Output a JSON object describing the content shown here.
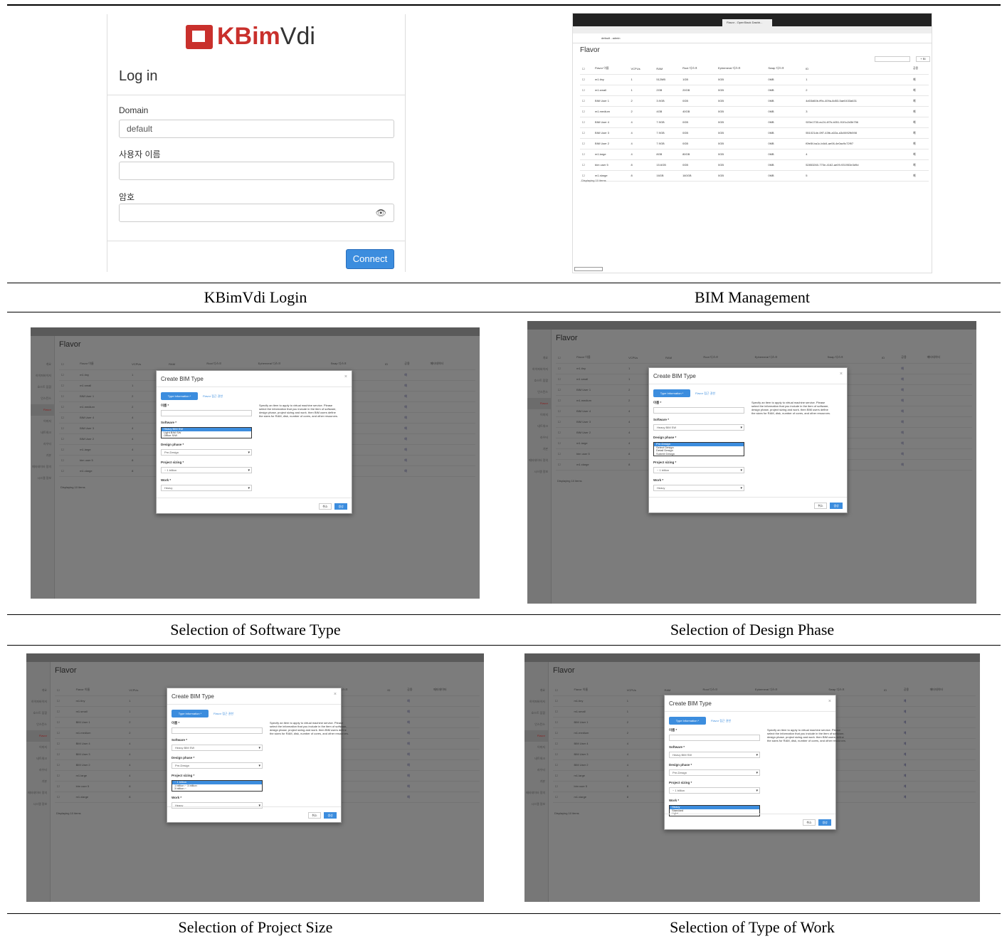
{
  "captions": {
    "login": "KBimVdi Login",
    "bim": "BIM Management",
    "software": "Selection of Software Type",
    "design": "Selection of Design Phase",
    "size": "Selection of Project Size",
    "work": "Selection of Type of Work"
  },
  "login": {
    "logo_kbim": "KBim",
    "logo_vdi": "Vdi",
    "title": "Log in",
    "domain_label": "Domain",
    "domain_value": "default",
    "user_label": "사용자 이름",
    "password_label": "암호",
    "connect": "Connect"
  },
  "bim": {
    "title": "Flavor",
    "admin": "default - admin",
    "tab": "Flavor - OpenStack Dashb...",
    "add_button": "+ BI",
    "columns": [
      "Flavor 이름",
      "VCPUs",
      "RAM",
      "Root 디스크",
      "Ephemeral 디스크",
      "Swap 디스크",
      "ID",
      "공용"
    ],
    "rows": [
      [
        "m1.tiny",
        "1",
        "512MB",
        "1GB",
        "0GB",
        "0MB",
        "1",
        "예"
      ],
      [
        "m1.small",
        "1",
        "2GB",
        "20GB",
        "0GB",
        "0MB",
        "2",
        "예"
      ],
      [
        "BIM User 1",
        "2",
        "3.9GB",
        "0GB",
        "0GB",
        "0MB",
        "4d03d60b-ff9c-409a-8d53-5ae0433a631",
        "예"
      ],
      [
        "m1.medium",
        "2",
        "4GB",
        "40GB",
        "0GB",
        "0MB",
        "3",
        "예"
      ],
      [
        "BIM User 4",
        "4",
        "7.9GB",
        "0GB",
        "0GB",
        "0MB",
        "920e1730-ec24-4f7b-b051-91f1c2d3b756",
        "예"
      ],
      [
        "BIM User 3",
        "4",
        "7.9GB",
        "0GB",
        "0GB",
        "0MB",
        "551021de-0ff7-43fb-a02a-a3c0692fb598",
        "예"
      ],
      [
        "BIM User 2",
        "4",
        "7.9GB",
        "0GB",
        "0GB",
        "0MB",
        "f0fe5f-ba1c-b4d4-ae06-4e0ac9c72f97",
        "예"
      ],
      [
        "m1.large",
        "4",
        "8GB",
        "80GB",
        "0GB",
        "0MB",
        "4",
        "예"
      ],
      [
        "bim user 5",
        "8",
        "15.6GB",
        "0GB",
        "0GB",
        "0MB",
        "52853260-770e-4162-ae09-931953e3d9d",
        "예"
      ],
      [
        "m1.xlarge",
        "8",
        "16GB",
        "160GB",
        "0GB",
        "0MB",
        "5",
        "예"
      ]
    ],
    "footer": "Displaying 10 items"
  },
  "dash": {
    "title": "Flavor",
    "short_columns": [
      "Flavor 이름",
      "VCPUs",
      "RAM",
      "Root 디스크",
      "Ephemeral 디스크",
      "Swap 디스크",
      "ID",
      "공용",
      "메타데이터"
    ],
    "short_rows": [
      [
        "m1.tiny",
        "1",
        "512MB"
      ],
      [
        "m1.small",
        "1",
        "2GB"
      ],
      [
        "BIM User 1",
        "2",
        "3.9GB"
      ],
      [
        "m1.medium",
        "2",
        "4GB"
      ],
      [
        "BIM User 4",
        "4",
        "7.9GB"
      ],
      [
        "BIM User 3",
        "4",
        "7.9GB"
      ],
      [
        "BIM User 2",
        "4",
        "7.9GB"
      ],
      [
        "m1.large",
        "4",
        "8GB"
      ],
      [
        "bim user 5",
        "8",
        "15.6GB"
      ],
      [
        "m1.xlarge",
        "8",
        "16GB"
      ]
    ],
    "footer": "Displaying 10 items",
    "side": [
      "개요",
      "하이퍼바이저",
      "호스트 집합",
      "인스턴스",
      "Flavor",
      "이미지",
      "네트워크",
      "라우터",
      "기본",
      "메타데이터 정의",
      "시스템 정보"
    ]
  },
  "modal": {
    "title": "Create BIM Type",
    "tab1": "Type Information *",
    "tab2": "Flavor 접근 권한",
    "name_label": "이름 *",
    "software_label": "Software *",
    "software_value": "Heavy BIM SW",
    "software_options": [
      "Heavy BIM SW",
      "Light BIM SW",
      "Office S/W"
    ],
    "design_label": "Design phase *",
    "design_value": "Pre-Design",
    "design_options": [
      "Pre-Design",
      "Select Design",
      "Detail Design",
      "Submit Design"
    ],
    "size_label": "Project sizing *",
    "size_value": "~ 1 billion",
    "size_options": [
      "~ 1 billion",
      "1 billion ~ 3 billion",
      "3 billion ~"
    ],
    "work_label": "Work *",
    "work_value": "Heavy",
    "work_options": [
      "Heavy",
      "Standard",
      "Light"
    ],
    "help": "Specify an item to apply to virtual machine service. Please select the information that you include in the item of software, design phase, project sizing and work. then BIM users define the sizes for RAM, disk, number of cores, and other resources.",
    "cancel": "취소",
    "create": "생성"
  }
}
